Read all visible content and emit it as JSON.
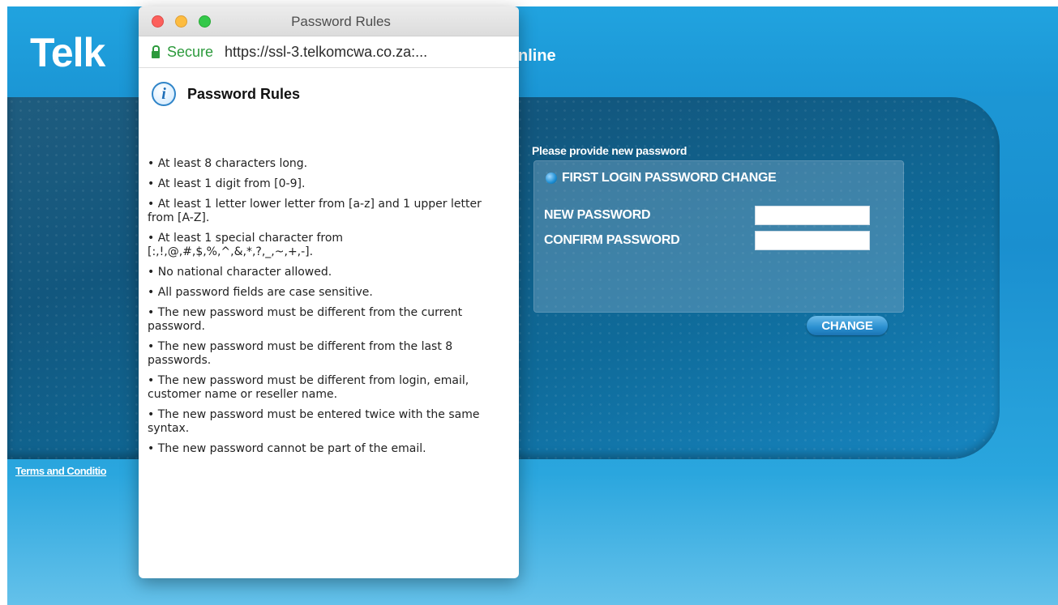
{
  "background_page": {
    "brand": "Telk",
    "header_tail": "nline",
    "terms_link": "Terms and Conditio",
    "provide_label": "Please provide new password",
    "form": {
      "title": "FIRST LOGIN PASSWORD CHANGE",
      "new_password_label": "NEW PASSWORD",
      "new_password_value": "",
      "confirm_password_label": "CONFIRM PASSWORD",
      "confirm_password_value": ""
    },
    "change_button": "CHANGE"
  },
  "popup": {
    "window_title": "Password Rules",
    "secure_label": "Secure",
    "url": "https://ssl-3.telkomcwa.co.za:...",
    "content_title": "Password Rules",
    "rules": [
      "At least 8 characters long.",
      "At least 1 digit from [0-9].",
      "At least 1 letter lower letter from [a-z] and 1 upper letter from [A-Z].",
      "At least 1 special character from [:,!,@,#,$,%,^,&,*,?,_,~,+,-].",
      "No national character allowed.",
      "All password fields are case sensitive.",
      "The new password must be different from the current password.",
      "The new password must be different from the last 8 passwords.",
      "The new password must be different from login, email, customer name or reseller name.",
      "The new password must be entered twice with the same syntax.",
      "The new password cannot be part of the email."
    ]
  },
  "colors": {
    "page_blue": "#1d9bd8",
    "panel_dark": "#12577e",
    "secure_green": "#2c9a3c",
    "info_blue": "#2f84c8"
  },
  "icons": {
    "lock": "lock-icon",
    "info": "info-icon",
    "form_bullet": "bullet-icon"
  }
}
